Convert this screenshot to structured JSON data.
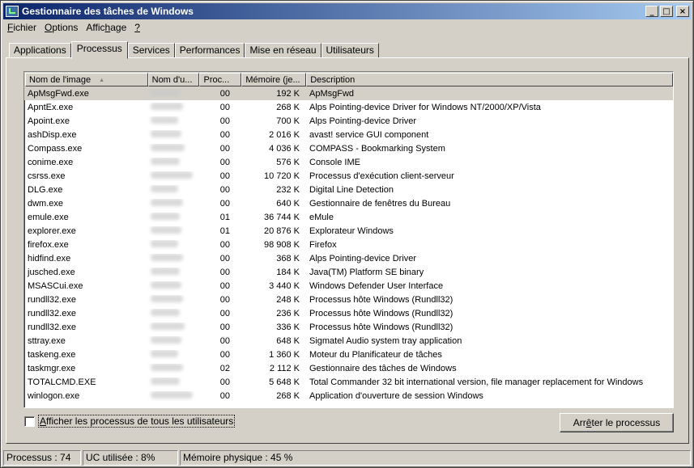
{
  "window": {
    "title": "Gestionnaire des tâches de Windows",
    "controls": {
      "minimize": "_",
      "maximize": "□",
      "close": "×"
    }
  },
  "menu": [
    {
      "pre": "",
      "key": "F",
      "post": "ichier"
    },
    {
      "pre": "",
      "key": "O",
      "post": "ptions"
    },
    {
      "pre": "Affic",
      "key": "h",
      "post": "age"
    },
    {
      "pre": "",
      "key": "?",
      "post": ""
    }
  ],
  "tabs": [
    "Applications",
    "Processus",
    "Services",
    "Performances",
    "Mise en réseau",
    "Utilisateurs"
  ],
  "active_tab": "Processus",
  "columns": {
    "name": "Nom de l'image",
    "user": "Nom d'u...",
    "cpu": "Proc...",
    "mem": "Mémoire (je...",
    "desc": "Description"
  },
  "processes": [
    {
      "name": "ApMsgFwd.exe",
      "cpu": "00",
      "mem": "192 K",
      "desc": "ApMsgFwd"
    },
    {
      "name": "ApntEx.exe",
      "cpu": "00",
      "mem": "268 K",
      "desc": "Alps Pointing-device Driver for Windows NT/2000/XP/Vista"
    },
    {
      "name": "Apoint.exe",
      "cpu": "00",
      "mem": "700 K",
      "desc": "Alps Pointing-device Driver"
    },
    {
      "name": "ashDisp.exe",
      "cpu": "00",
      "mem": "2 016 K",
      "desc": "avast! service GUI component"
    },
    {
      "name": "Compass.exe",
      "cpu": "00",
      "mem": "4 036 K",
      "desc": "COMPASS - Bookmarking System"
    },
    {
      "name": "conime.exe",
      "cpu": "00",
      "mem": "576 K",
      "desc": "Console IME"
    },
    {
      "name": "csrss.exe",
      "cpu": "00",
      "mem": "10 720 K",
      "desc": "Processus d'exécution client-serveur"
    },
    {
      "name": "DLG.exe",
      "cpu": "00",
      "mem": "232 K",
      "desc": "Digital Line Detection"
    },
    {
      "name": "dwm.exe",
      "cpu": "00",
      "mem": "640 K",
      "desc": "Gestionnaire de fenêtres du Bureau"
    },
    {
      "name": "emule.exe",
      "cpu": "01",
      "mem": "36 744 K",
      "desc": "eMule"
    },
    {
      "name": "explorer.exe",
      "cpu": "01",
      "mem": "20 876 K",
      "desc": "Explorateur Windows"
    },
    {
      "name": "firefox.exe",
      "cpu": "00",
      "mem": "98 908 K",
      "desc": "Firefox"
    },
    {
      "name": "hidfind.exe",
      "cpu": "00",
      "mem": "368 K",
      "desc": "Alps Pointing-device Driver"
    },
    {
      "name": "jusched.exe",
      "cpu": "00",
      "mem": "184 K",
      "desc": "Java(TM) Platform SE binary"
    },
    {
      "name": "MSASCui.exe",
      "cpu": "00",
      "mem": "3 440 K",
      "desc": "Windows Defender User Interface"
    },
    {
      "name": "rundll32.exe",
      "cpu": "00",
      "mem": "248 K",
      "desc": "Processus hôte Windows (Rundll32)"
    },
    {
      "name": "rundll32.exe",
      "cpu": "00",
      "mem": "236 K",
      "desc": "Processus hôte Windows (Rundll32)"
    },
    {
      "name": "rundll32.exe",
      "cpu": "00",
      "mem": "336 K",
      "desc": "Processus hôte Windows (Rundll32)"
    },
    {
      "name": "sttray.exe",
      "cpu": "00",
      "mem": "648 K",
      "desc": "Sigmatel Audio system tray application"
    },
    {
      "name": "taskeng.exe",
      "cpu": "00",
      "mem": "1 360 K",
      "desc": "Moteur du Planificateur de tâches"
    },
    {
      "name": "taskmgr.exe",
      "cpu": "02",
      "mem": "2 112 K",
      "desc": "Gestionnaire des tâches de Windows"
    },
    {
      "name": "TOTALCMD.EXE",
      "cpu": "00",
      "mem": "5 648 K",
      "desc": "Total Commander 32 bit international version, file manager replacement for Windows"
    },
    {
      "name": "winlogon.exe",
      "cpu": "00",
      "mem": "268 K",
      "desc": "Application d'ouverture de session Windows"
    }
  ],
  "selected_row": 0,
  "show_all_users": {
    "pre": "",
    "key": "A",
    "post": "fficher les processus de tous les utilisateurs",
    "checked": false
  },
  "end_process": {
    "pre": "Arr",
    "key": "ê",
    "post": "ter le processus"
  },
  "status": {
    "processes": "Processus : 74",
    "cpu": "UC utilisée : 8%",
    "memory": "Mémoire physique : 45 %"
  },
  "colors": {
    "face": "#d4d0c8",
    "title_start": "#0a246a",
    "title_end": "#a6caf0",
    "list_bg": "#ffffff"
  }
}
